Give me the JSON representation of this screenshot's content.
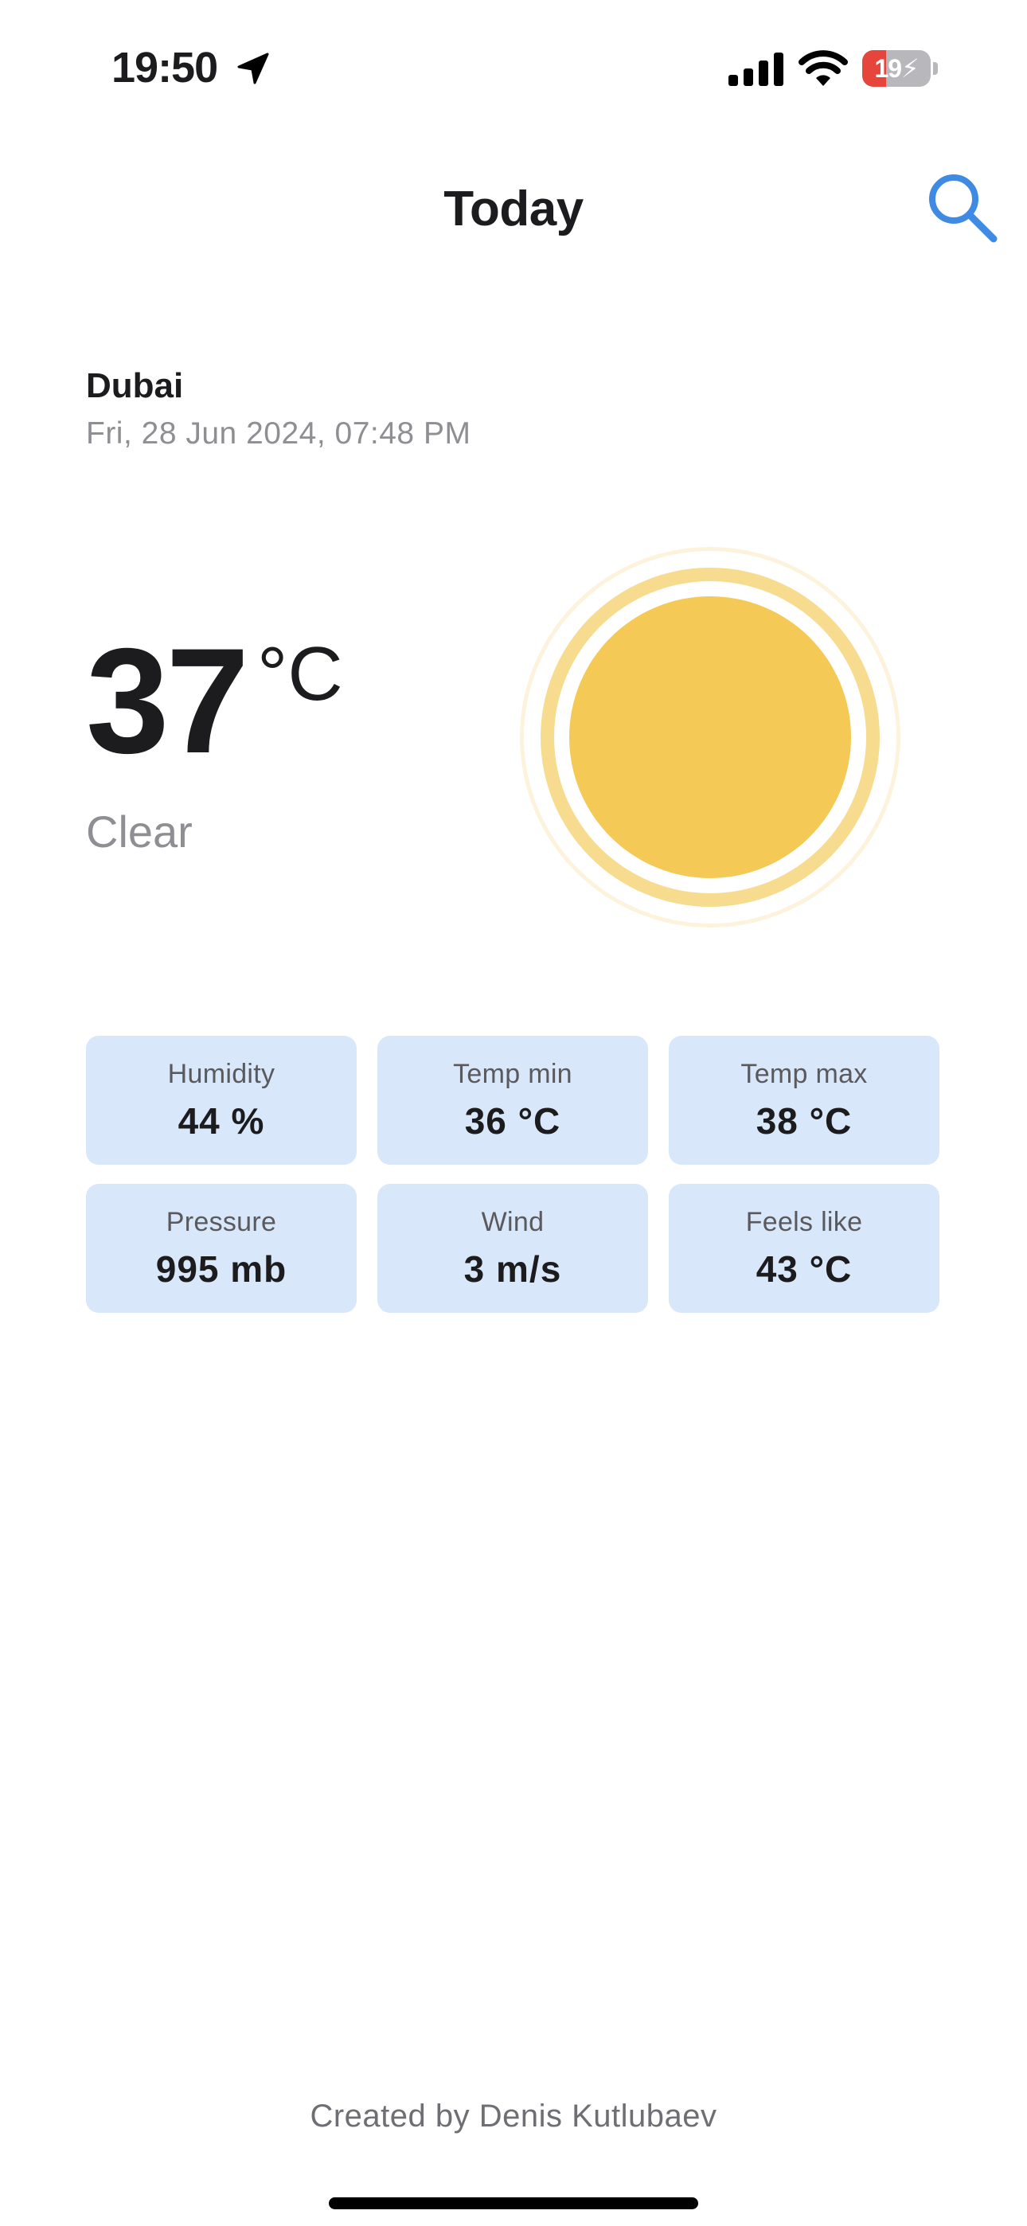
{
  "status_bar": {
    "time": "19:50",
    "battery_level": "19",
    "battery_fraction": 0.19,
    "battery_color": "#e5453b",
    "icons": [
      "location-arrow-icon",
      "cellular-signal-icon",
      "wifi-icon",
      "battery-charging-icon"
    ]
  },
  "header": {
    "title": "Today",
    "search_icon": "search-icon",
    "accent_color": "#3f8be3"
  },
  "location": {
    "city": "Dubai",
    "datetime": "Fri, 28 Jun 2024, 07:48 PM"
  },
  "current": {
    "temperature": "37",
    "unit": "°C",
    "condition": "Clear",
    "condition_icon": "sun-icon",
    "sun_color": "#f5c955"
  },
  "stats": [
    {
      "label": "Humidity",
      "value": "44 %"
    },
    {
      "label": "Temp min",
      "value": "36 °C"
    },
    {
      "label": "Temp max",
      "value": "38 °C"
    },
    {
      "label": "Pressure",
      "value": "995 mb"
    },
    {
      "label": "Wind",
      "value": "3 m/s"
    },
    {
      "label": "Feels like",
      "value": "43 °C"
    }
  ],
  "stats_card_color": "#d8e7f9",
  "footer": {
    "credit": "Created by Denis Kutlubaev"
  }
}
